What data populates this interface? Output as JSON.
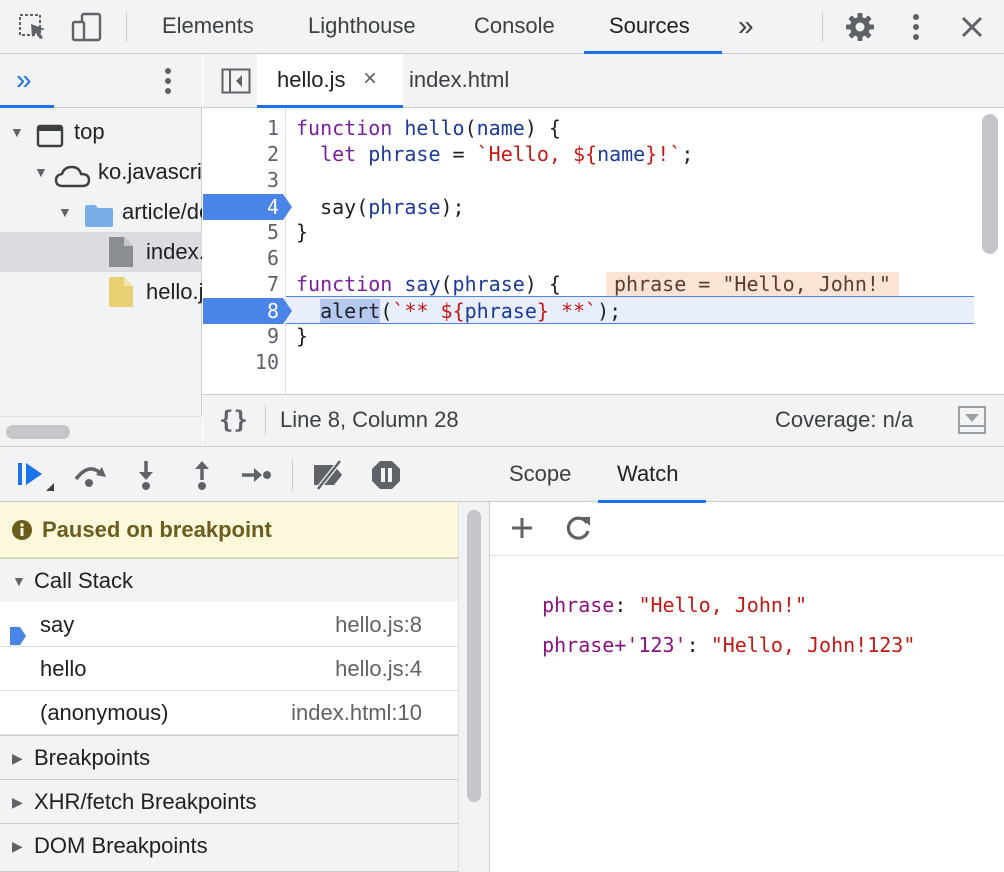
{
  "toolbar": {
    "tabs": [
      {
        "label": "Elements"
      },
      {
        "label": "Lighthouse"
      },
      {
        "label": "Console"
      },
      {
        "label": "Sources"
      }
    ],
    "more_label": "»"
  },
  "navigator": {
    "items": [
      {
        "label": "top"
      },
      {
        "label": "ko.javascript.info"
      },
      {
        "label": "article/debugging-chrome"
      },
      {
        "label": "index.html"
      },
      {
        "label": "hello.js"
      }
    ]
  },
  "editor": {
    "tabs": [
      {
        "label": "hello.js",
        "close": "×"
      },
      {
        "label": "index.html"
      }
    ],
    "lines": [
      "1",
      "2",
      "3",
      "4",
      "5",
      "6",
      "7",
      "8",
      "9",
      "10"
    ],
    "inline_value": "phrase = \"Hello, John!\"",
    "status": {
      "pretty_print": "{}",
      "position": "Line 8, Column 28",
      "coverage": "Coverage: n/a"
    }
  },
  "debugger": {
    "paused_message": "Paused on breakpoint",
    "call_stack_label": "Call Stack",
    "call_stack": [
      {
        "name": "say",
        "location": "hello.js:8"
      },
      {
        "name": "hello",
        "location": "hello.js:4"
      },
      {
        "name": "(anonymous)",
        "location": "index.html:10"
      }
    ],
    "sections": [
      {
        "label": "Breakpoints"
      },
      {
        "label": "XHR/fetch Breakpoints"
      },
      {
        "label": "DOM Breakpoints"
      }
    ]
  },
  "sidebar": {
    "tabs": [
      {
        "label": "Scope"
      },
      {
        "label": "Watch"
      }
    ],
    "watch": [
      {
        "expr": "phrase",
        "sep": ": ",
        "value": "\"Hello, John!\""
      },
      {
        "expr": "phrase+'123'",
        "sep": ": ",
        "value": "\"Hello, John!123\""
      }
    ]
  },
  "colors": {
    "accent": "#1a73e8",
    "breakpoint": "#4a84e8",
    "paused_bg": "#fcf8dc",
    "execution_line": "#e8eefb"
  }
}
